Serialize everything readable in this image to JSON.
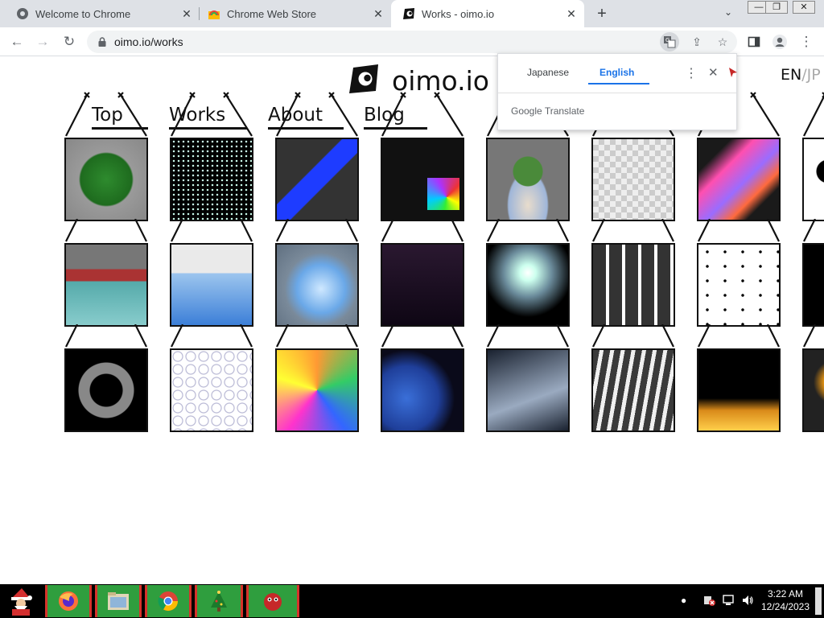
{
  "browser": {
    "tabs": [
      {
        "title": "Welcome to Chrome",
        "icon": "chrome-icon",
        "active": false
      },
      {
        "title": "Chrome Web Store",
        "icon": "web-store-icon",
        "active": false
      },
      {
        "title": "Works - oimo.io",
        "icon": "oimo-logo-icon",
        "active": true
      }
    ],
    "new_tab_label": "+",
    "url": "oimo.io/works"
  },
  "site": {
    "title": "oimo.io",
    "lang_en": "EN",
    "lang_sep": "/",
    "lang_jp": "JP",
    "nav": [
      "Top",
      "Works",
      "About",
      "Blog"
    ]
  },
  "translate_popup": {
    "source_lang": "Japanese",
    "target_lang": "English",
    "brand_google": "Google",
    "brand_translate": "Translate"
  },
  "gallery": {
    "rows": [
      [
        "green-sphere",
        "dot-matrix",
        "physics-boxes",
        "code-cube",
        "bonsai-tree",
        "checker-cloth",
        "voxel-gradient",
        "ink-splash"
      ],
      [
        "paper-boat-water",
        "fluid-pool",
        "glass-fluid",
        "digital-clock",
        "smoke",
        "thumbnail-grid",
        "node-graph",
        "dark-blob"
      ],
      [
        "race-track",
        "bubble-sketch",
        "color-cubes",
        "blue-ocean",
        "falling-shards",
        "ribbons",
        "particle-fire",
        "sun-flower"
      ]
    ]
  },
  "taskbar": {
    "time": "3:22 AM",
    "date": "12/24/2023",
    "apps": [
      "santa-start-icon",
      "firefox-icon",
      "file-manager-icon",
      "chrome-icon",
      "christmas-tree-icon",
      "red-creature-icon"
    ]
  },
  "colors": {
    "tab_strip": "#dee1e6",
    "accent_blue": "#1a73e8",
    "taskbar_green": "#2f9e3e",
    "taskbar_red": "#d6332b"
  }
}
